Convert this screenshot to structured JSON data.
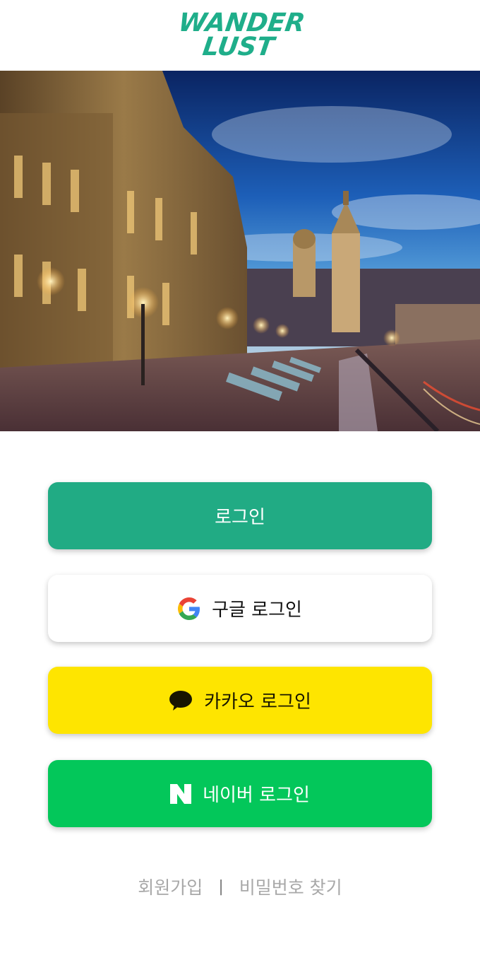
{
  "logo": {
    "line1": "WANDER",
    "line2": "LUST"
  },
  "hero": {
    "alt": "city-night-photo"
  },
  "buttons": {
    "login": "로그인",
    "google": "구글 로그인",
    "kakao": "카카오 로그인",
    "naver": "네이버 로그인"
  },
  "icons": {
    "google": "google-icon",
    "kakao": "kakao-chat-icon",
    "naver": "naver-icon"
  },
  "footer": {
    "signup": "회원가입",
    "separator": "|",
    "find_password": "비밀번호 찾기"
  },
  "colors": {
    "brand": "#21ab84",
    "kakao": "#fee500",
    "naver": "#03c75a",
    "link": "#a8a8a8"
  }
}
